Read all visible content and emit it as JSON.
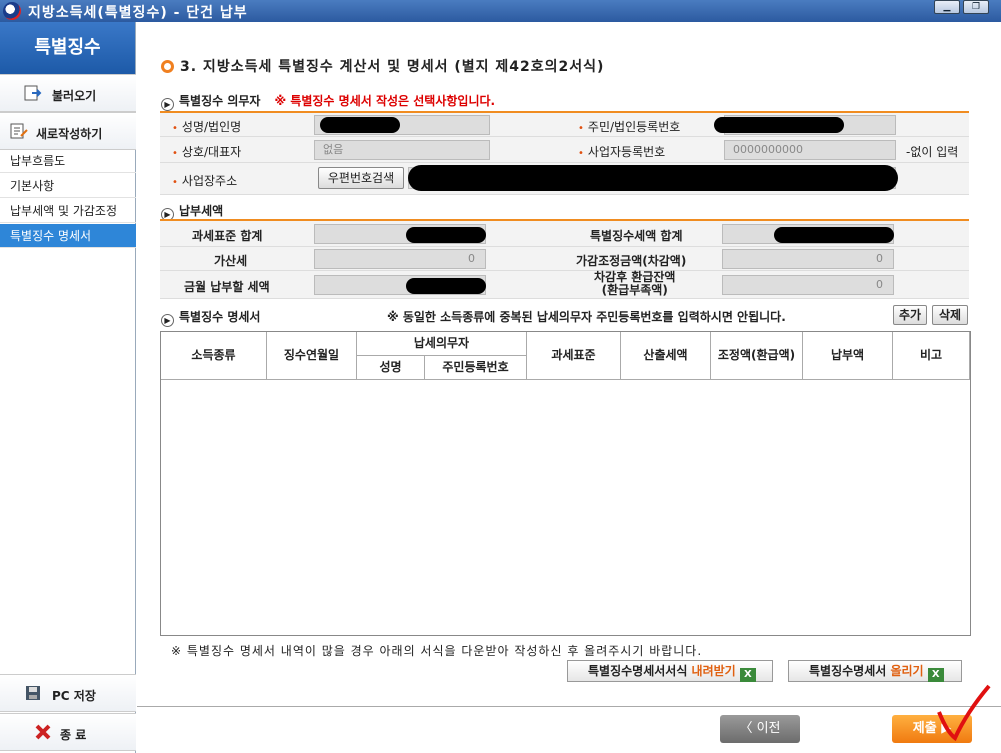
{
  "window": {
    "title": "지방소득세(특별징수) - 단건 납부"
  },
  "sidebar": {
    "header": "특별징수",
    "load_label": "불러오기",
    "new_label": "새로작성하기",
    "links": [
      "납부흐름도",
      "기본사항",
      "납부세액 및 가감조정",
      "특별징수 명세서"
    ],
    "save_label": "PC 저장",
    "exit_label": "종 료"
  },
  "main": {
    "title": "3. 지방소득세 특별징수 계산서 및 명세서 (별지 제42호의2서식)",
    "payer": {
      "heading": "특별징수 의무자",
      "note": "※ 특별징수 명세서 작성은 선택사항입니다.",
      "name_label": "성명/법인명",
      "id_label": "주민/법인등록번호",
      "company_label": "상호/대표자",
      "company_value": "없음",
      "bizno_label": "사업자등록번호",
      "bizno_value": "0000000000",
      "bizno_note": "-없이 입력",
      "addr_label": "사업장주소",
      "postal_button": "우편번호검색"
    },
    "tax": {
      "heading": "납부세액",
      "base_label": "과세표준 합계",
      "special_label": "특별징수세액 합계",
      "extra_label": "가산세",
      "extra_value": "0",
      "adjust_label": "가감조정금액(차감액)",
      "adjust_value": "0",
      "pay_label": "금월 납부할 세액",
      "refund_label": "차감후 환급잔액",
      "refund_label2": "(환급부족액)",
      "refund_value": "0"
    },
    "detail": {
      "heading": "특별징수 명세서",
      "note": "※ 동일한 소득종류에 중복된 납세의무자 주민등록번호를 입력하시면 안됩니다.",
      "add_button": "추가",
      "delete_button": "삭제",
      "columns": {
        "income": "소득종류",
        "month": "징수연월일",
        "payer": "납세의무자",
        "name": "성명",
        "rrn": "주민등록번호",
        "base": "과세표준",
        "calc": "산출세액",
        "adjust": "조정액(환급액)",
        "paid": "납부액",
        "remark": "비고"
      }
    },
    "footer_note": "※ 특별징수 명세서 내역이 많을 경우 아래의 서식을 다운받아 작성하신 후 올려주시기 바랍니다.",
    "download": {
      "prefix": "특별징수명세서서식 ",
      "accent": "내려받기"
    },
    "upload": {
      "prefix": "특별징수명세서 ",
      "accent": "올리기"
    },
    "prev_button": "〈 이전",
    "submit_button": "제출 ▶"
  }
}
